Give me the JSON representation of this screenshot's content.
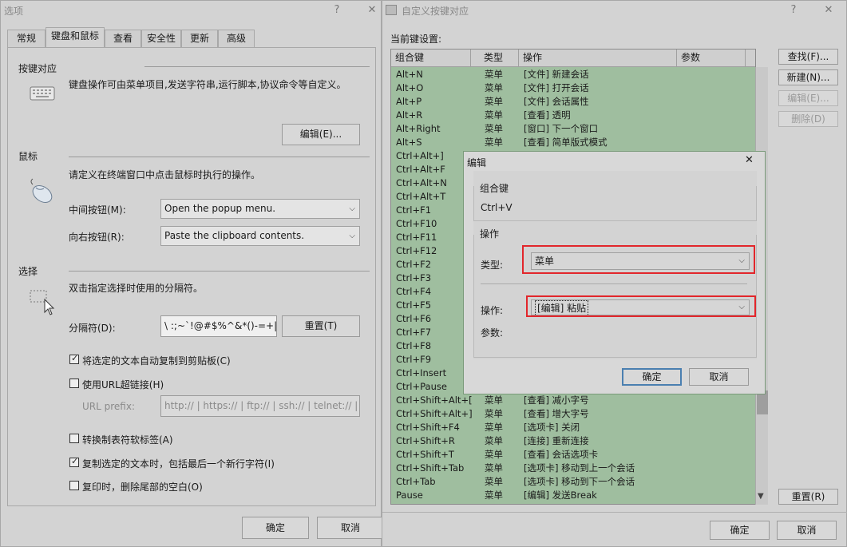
{
  "options_window": {
    "title": "选项",
    "help_button": "?",
    "close_button": "✕",
    "tabs": [
      "常规",
      "键盘和鼠标",
      "查看",
      "安全性",
      "更新",
      "高级"
    ],
    "keymap": {
      "title": "按键对应",
      "description": "键盘操作可由菜单项目,发送字符串,运行脚本,协议命令等自定义。",
      "edit_button": "编辑(E)..."
    },
    "mouse": {
      "title": "鼠标",
      "description": "请定义在终端窗口中点击鼠标时执行的操作。",
      "middle_label": "中间按钮(M):",
      "middle_value": "Open the popup menu.",
      "right_label": "向右按钮(R):",
      "right_value": "Paste the clipboard contents."
    },
    "selection": {
      "title": "选择",
      "description": "双击指定选择时使用的分隔符。",
      "delimiter_label": "分隔符(D):",
      "delimiter_value": "\\ :;~`!@#$%^&*()-=+|[]{}",
      "reset_button": "重置(T)"
    },
    "checkboxes": [
      {
        "label": "将选定的文本自动复制到剪贴板(C)",
        "checked": true
      },
      {
        "label": "使用URL超链接(H)",
        "checked": false
      },
      {
        "label": "转换制表符软标签(A)",
        "checked": false
      },
      {
        "label": "复制选定的文本时，包括最后一个新行字符(I)",
        "checked": true
      },
      {
        "label": "复印时，删除尾部的空白(O)",
        "checked": false
      }
    ],
    "url_prefix_label": "URL prefix:",
    "url_prefix_value": "http:// | https:// | ftp:// | ssh:// | telnet:// |",
    "ok_button": "确定",
    "cancel_button": "取消"
  },
  "keymap_window": {
    "title": "自定义按键对应",
    "help_button": "?",
    "close_button": "✕",
    "current_label": "当前键设置:",
    "columns": [
      "组合键",
      "类型",
      "操作",
      "参数"
    ],
    "rows": [
      [
        "Alt+N",
        "菜单",
        "[文件] 新建会话"
      ],
      [
        "Alt+O",
        "菜单",
        "[文件] 打开会话"
      ],
      [
        "Alt+P",
        "菜单",
        "[文件] 会话属性"
      ],
      [
        "Alt+R",
        "菜单",
        "[查看] 透明"
      ],
      [
        "Alt+Right",
        "菜单",
        "[窗口] 下一个窗口"
      ],
      [
        "Alt+S",
        "菜单",
        "[查看] 简单版式模式"
      ],
      [
        "Ctrl+Alt+]",
        "",
        ""
      ],
      [
        "Ctrl+Alt+F",
        "",
        ""
      ],
      [
        "Ctrl+Alt+N",
        "",
        ""
      ],
      [
        "Ctrl+Alt+T",
        "",
        ""
      ],
      [
        "Ctrl+F1",
        "",
        ""
      ],
      [
        "Ctrl+F10",
        "",
        ""
      ],
      [
        "Ctrl+F11",
        "",
        ""
      ],
      [
        "Ctrl+F12",
        "",
        ""
      ],
      [
        "Ctrl+F2",
        "",
        ""
      ],
      [
        "Ctrl+F3",
        "",
        ""
      ],
      [
        "Ctrl+F4",
        "",
        ""
      ],
      [
        "Ctrl+F5",
        "",
        ""
      ],
      [
        "Ctrl+F6",
        "",
        ""
      ],
      [
        "Ctrl+F7",
        "",
        ""
      ],
      [
        "Ctrl+F8",
        "",
        ""
      ],
      [
        "Ctrl+F9",
        "",
        ""
      ],
      [
        "Ctrl+Insert",
        "",
        ""
      ],
      [
        "Ctrl+Pause",
        "",
        ""
      ],
      [
        "Ctrl+Shift+Alt+[",
        "菜单",
        "[查看] 减小字号"
      ],
      [
        "Ctrl+Shift+Alt+]",
        "菜单",
        "[查看] 增大字号"
      ],
      [
        "Ctrl+Shift+F4",
        "菜单",
        "[选项卡] 关闭"
      ],
      [
        "Ctrl+Shift+R",
        "菜单",
        "[连接] 重新连接"
      ],
      [
        "Ctrl+Shift+T",
        "菜单",
        "[查看] 会话选项卡"
      ],
      [
        "Ctrl+Shift+Tab",
        "菜单",
        "[选项卡] 移动到上一个会话"
      ],
      [
        "Ctrl+Tab",
        "菜单",
        "[选项卡] 移动到下一个会话"
      ],
      [
        "Pause",
        "菜单",
        "[编辑] 发送Break"
      ]
    ],
    "buttons": {
      "find": "查找(F)...",
      "new": "新建(N)...",
      "edit": "编辑(E)...",
      "delete": "删除(D)",
      "reset": "重置(R)",
      "ok": "确定",
      "cancel": "取消"
    }
  },
  "edit_dialog": {
    "title": "编辑",
    "close_button": "✕",
    "combo_group": "组合键",
    "combo_value": "Ctrl+V",
    "action_group": "操作",
    "type_label": "类型:",
    "type_value": "菜单",
    "action_label": "操作:",
    "action_value": "[编辑] 粘贴",
    "param_label": "参数:",
    "ok_button": "确定",
    "cancel_button": "取消"
  },
  "colors": {
    "list_background": "#9fbe9f",
    "highlight_border": "#e2262b"
  }
}
